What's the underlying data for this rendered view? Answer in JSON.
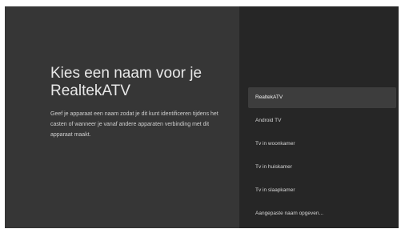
{
  "setup": {
    "title": "Kies een naam voor je RealtekATV",
    "description": "Geef je apparaat een naam zodat je dit kunt identificeren tijdens het casten of wanneer je vanaf andere apparaten verbinding met dit apparaat maakt.",
    "options": [
      {
        "label": "RealtekATV",
        "selected": true
      },
      {
        "label": "Android TV",
        "selected": false
      },
      {
        "label": "Tv in woonkamer",
        "selected": false
      },
      {
        "label": "Tv in huiskamer",
        "selected": false
      },
      {
        "label": "Tv in slaapkamer",
        "selected": false
      },
      {
        "label": "Aangepaste naam opgeven...",
        "selected": false
      }
    ]
  },
  "colors": {
    "left_panel": "#363636",
    "right_panel": "#262626",
    "selected_item": "#3d3d3d"
  }
}
